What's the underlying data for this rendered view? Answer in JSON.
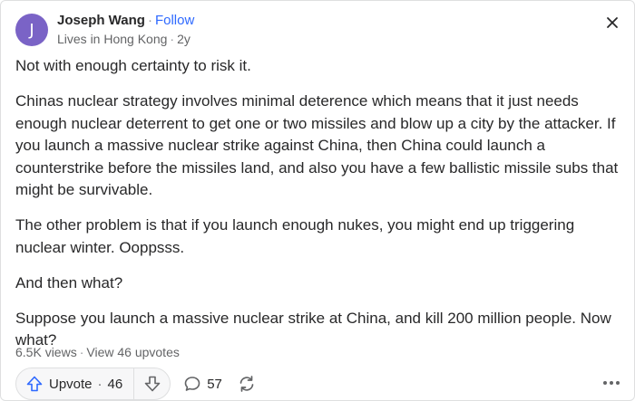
{
  "post": {
    "author": {
      "avatar_initial": "J",
      "avatar_color": "#7a63c6",
      "name": "Joseph Wang",
      "separator": "·",
      "follow_label": "Follow",
      "location": "Lives in Hong Kong",
      "age": "2y"
    },
    "paragraphs": [
      "Not with enough certainty to risk it.",
      "Chinas nuclear strategy involves minimal deterence which means that it just needs enough nuclear deterrent to get one or two missiles and blow up a city by the attacker. If you launch a massive nuclear strike against China, then China could launch a counterstrike before the missiles land, and also you have a few ballistic missile subs that might be survivable.",
      "The other problem is that if you launch enough nukes, you might end up triggering nuclear winter. Ooppsss.",
      "And then what?",
      "Suppose you launch a massive nuclear strike at China, and kill 200 million people. Now what?"
    ],
    "stats": {
      "views": "6.5K views",
      "separator": "·",
      "upvotes_link": "View 46 upvotes"
    },
    "actions": {
      "upvote_label": "Upvote",
      "upvote_sep": "·",
      "upvote_count": "46",
      "comment_count": "57"
    },
    "icons": {
      "close": "close-icon",
      "upvote": "upvote-arrow-icon",
      "downvote": "downvote-arrow-icon",
      "comment": "comment-bubble-icon",
      "share": "share-cycle-icon",
      "more": "more-dots-icon"
    },
    "colors": {
      "accent": "#2e69ff",
      "text": "#282829",
      "muted": "#636466"
    }
  }
}
